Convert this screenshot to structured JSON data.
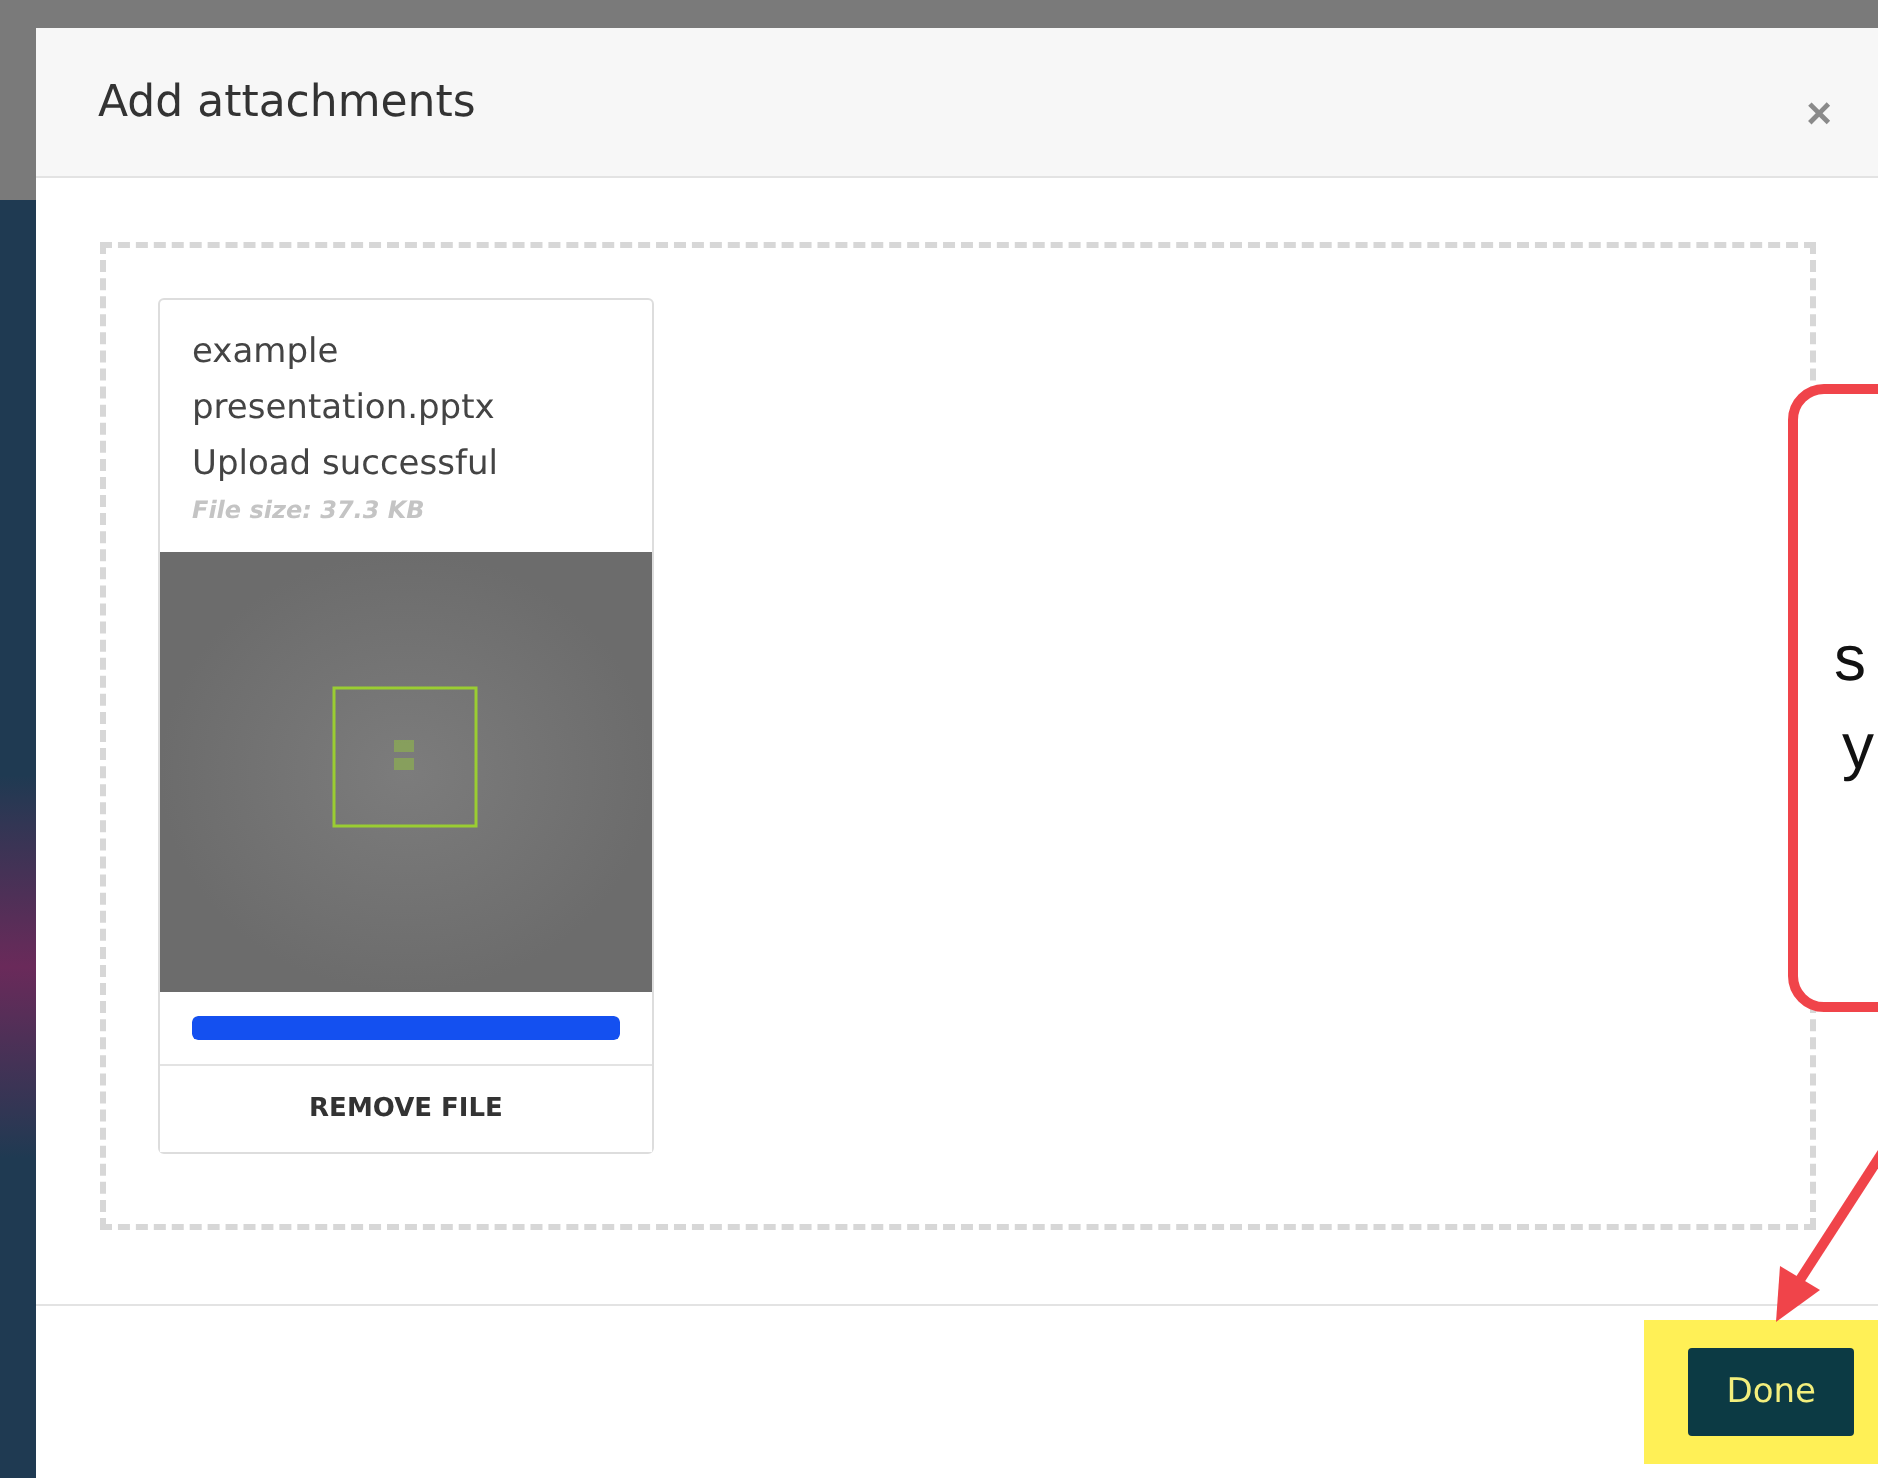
{
  "dialog": {
    "title": "Add attachments",
    "close": "×"
  },
  "files": [
    {
      "name": "example presentation.pptx",
      "status": "Upload successful",
      "size": "File size: 37.3 KB",
      "progress": {
        "level": 1
      },
      "remove": "REMOVE FILE"
    }
  ],
  "callout": {
    "lines": [
      "s",
      "y"
    ]
  },
  "footer": {
    "done": "Done",
    "highlighted": true
  }
}
